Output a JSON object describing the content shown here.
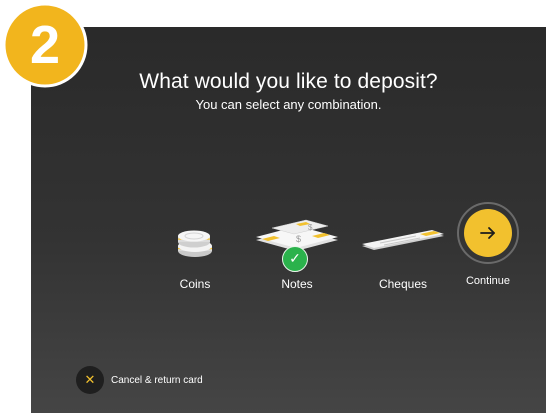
{
  "step": {
    "number": "2"
  },
  "header": {
    "title": "What would you like to deposit?",
    "subtitle": "You can select any combination."
  },
  "options": [
    {
      "label": "Coins",
      "selected": false,
      "icon": "coins-icon"
    },
    {
      "label": "Notes",
      "selected": true,
      "icon": "notes-icon"
    },
    {
      "label": "Cheques",
      "selected": false,
      "icon": "cheque-icon"
    }
  ],
  "selected_mark": "✓",
  "continue": {
    "label": "Continue",
    "icon": "arrow-right-icon"
  },
  "cancel": {
    "label": "Cancel & return card",
    "icon": "close-icon",
    "glyph": "✕"
  },
  "colors": {
    "accent": "#f2c12e",
    "success": "#2bb24c",
    "background": "#333333"
  }
}
